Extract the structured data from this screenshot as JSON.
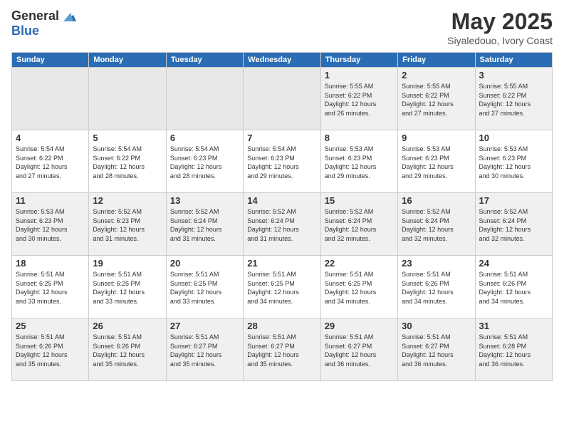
{
  "header": {
    "logo_line1": "General",
    "logo_line2": "Blue",
    "title": "May 2025",
    "subtitle": "Siyaledouo, Ivory Coast"
  },
  "weekdays": [
    "Sunday",
    "Monday",
    "Tuesday",
    "Wednesday",
    "Thursday",
    "Friday",
    "Saturday"
  ],
  "weeks": [
    [
      {
        "day": "",
        "info": ""
      },
      {
        "day": "",
        "info": ""
      },
      {
        "day": "",
        "info": ""
      },
      {
        "day": "",
        "info": ""
      },
      {
        "day": "1",
        "info": "Sunrise: 5:55 AM\nSunset: 6:22 PM\nDaylight: 12 hours\nand 26 minutes."
      },
      {
        "day": "2",
        "info": "Sunrise: 5:55 AM\nSunset: 6:22 PM\nDaylight: 12 hours\nand 27 minutes."
      },
      {
        "day": "3",
        "info": "Sunrise: 5:55 AM\nSunset: 6:22 PM\nDaylight: 12 hours\nand 27 minutes."
      }
    ],
    [
      {
        "day": "4",
        "info": "Sunrise: 5:54 AM\nSunset: 6:22 PM\nDaylight: 12 hours\nand 27 minutes."
      },
      {
        "day": "5",
        "info": "Sunrise: 5:54 AM\nSunset: 6:22 PM\nDaylight: 12 hours\nand 28 minutes."
      },
      {
        "day": "6",
        "info": "Sunrise: 5:54 AM\nSunset: 6:23 PM\nDaylight: 12 hours\nand 28 minutes."
      },
      {
        "day": "7",
        "info": "Sunrise: 5:54 AM\nSunset: 6:23 PM\nDaylight: 12 hours\nand 29 minutes."
      },
      {
        "day": "8",
        "info": "Sunrise: 5:53 AM\nSunset: 6:23 PM\nDaylight: 12 hours\nand 29 minutes."
      },
      {
        "day": "9",
        "info": "Sunrise: 5:53 AM\nSunset: 6:23 PM\nDaylight: 12 hours\nand 29 minutes."
      },
      {
        "day": "10",
        "info": "Sunrise: 5:53 AM\nSunset: 6:23 PM\nDaylight: 12 hours\nand 30 minutes."
      }
    ],
    [
      {
        "day": "11",
        "info": "Sunrise: 5:53 AM\nSunset: 6:23 PM\nDaylight: 12 hours\nand 30 minutes."
      },
      {
        "day": "12",
        "info": "Sunrise: 5:52 AM\nSunset: 6:23 PM\nDaylight: 12 hours\nand 31 minutes."
      },
      {
        "day": "13",
        "info": "Sunrise: 5:52 AM\nSunset: 6:24 PM\nDaylight: 12 hours\nand 31 minutes."
      },
      {
        "day": "14",
        "info": "Sunrise: 5:52 AM\nSunset: 6:24 PM\nDaylight: 12 hours\nand 31 minutes."
      },
      {
        "day": "15",
        "info": "Sunrise: 5:52 AM\nSunset: 6:24 PM\nDaylight: 12 hours\nand 32 minutes."
      },
      {
        "day": "16",
        "info": "Sunrise: 5:52 AM\nSunset: 6:24 PM\nDaylight: 12 hours\nand 32 minutes."
      },
      {
        "day": "17",
        "info": "Sunrise: 5:52 AM\nSunset: 6:24 PM\nDaylight: 12 hours\nand 32 minutes."
      }
    ],
    [
      {
        "day": "18",
        "info": "Sunrise: 5:51 AM\nSunset: 6:25 PM\nDaylight: 12 hours\nand 33 minutes."
      },
      {
        "day": "19",
        "info": "Sunrise: 5:51 AM\nSunset: 6:25 PM\nDaylight: 12 hours\nand 33 minutes."
      },
      {
        "day": "20",
        "info": "Sunrise: 5:51 AM\nSunset: 6:25 PM\nDaylight: 12 hours\nand 33 minutes."
      },
      {
        "day": "21",
        "info": "Sunrise: 5:51 AM\nSunset: 6:25 PM\nDaylight: 12 hours\nand 34 minutes."
      },
      {
        "day": "22",
        "info": "Sunrise: 5:51 AM\nSunset: 6:25 PM\nDaylight: 12 hours\nand 34 minutes."
      },
      {
        "day": "23",
        "info": "Sunrise: 5:51 AM\nSunset: 6:26 PM\nDaylight: 12 hours\nand 34 minutes."
      },
      {
        "day": "24",
        "info": "Sunrise: 5:51 AM\nSunset: 6:26 PM\nDaylight: 12 hours\nand 34 minutes."
      }
    ],
    [
      {
        "day": "25",
        "info": "Sunrise: 5:51 AM\nSunset: 6:26 PM\nDaylight: 12 hours\nand 35 minutes."
      },
      {
        "day": "26",
        "info": "Sunrise: 5:51 AM\nSunset: 6:26 PM\nDaylight: 12 hours\nand 35 minutes."
      },
      {
        "day": "27",
        "info": "Sunrise: 5:51 AM\nSunset: 6:27 PM\nDaylight: 12 hours\nand 35 minutes."
      },
      {
        "day": "28",
        "info": "Sunrise: 5:51 AM\nSunset: 6:27 PM\nDaylight: 12 hours\nand 35 minutes."
      },
      {
        "day": "29",
        "info": "Sunrise: 5:51 AM\nSunset: 6:27 PM\nDaylight: 12 hours\nand 36 minutes."
      },
      {
        "day": "30",
        "info": "Sunrise: 5:51 AM\nSunset: 6:27 PM\nDaylight: 12 hours\nand 36 minutes."
      },
      {
        "day": "31",
        "info": "Sunrise: 5:51 AM\nSunset: 6:28 PM\nDaylight: 12 hours\nand 36 minutes."
      }
    ]
  ]
}
